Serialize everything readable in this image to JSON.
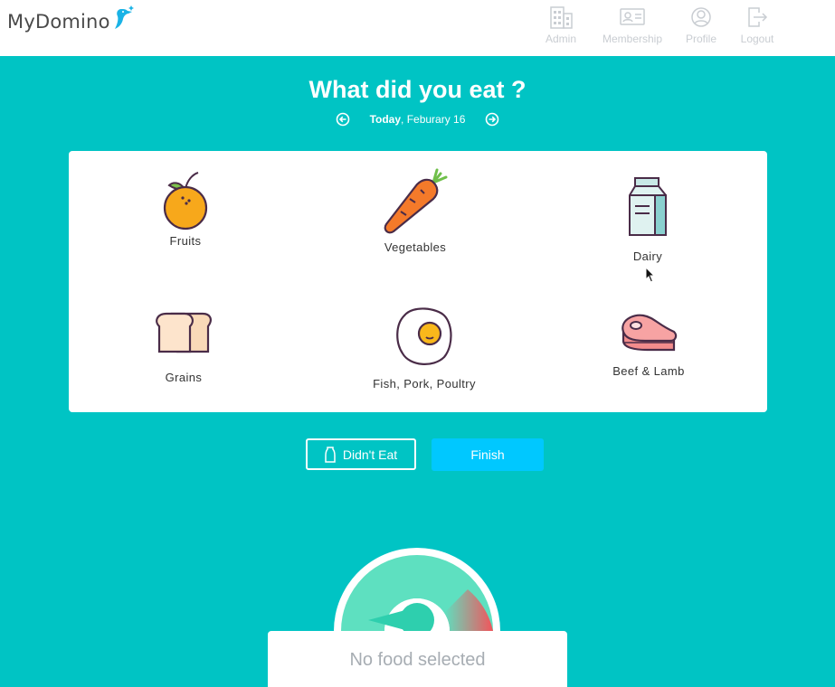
{
  "app": {
    "logo_text": "MyDomino"
  },
  "nav": {
    "items": [
      {
        "label": "Admin",
        "icon": "building-icon"
      },
      {
        "label": "Membership",
        "icon": "id-card-icon"
      },
      {
        "label": "Profile",
        "icon": "user-circle-icon"
      },
      {
        "label": "Logout",
        "icon": "logout-icon"
      }
    ]
  },
  "page": {
    "title": "What did you eat ?",
    "date_bold": "Today",
    "date_rest": ", Feburary 16"
  },
  "foods": [
    {
      "label": "Fruits",
      "icon": "orange-icon"
    },
    {
      "label": "Vegetables",
      "icon": "carrot-icon"
    },
    {
      "label": "Dairy",
      "icon": "milk-carton-icon"
    },
    {
      "label": "Grains",
      "icon": "bread-icon"
    },
    {
      "label": "Fish, Pork, Poultry",
      "icon": "egg-icon"
    },
    {
      "label": "Beef & Lamb",
      "icon": "steak-icon"
    }
  ],
  "actions": {
    "didnt_eat": "Didn't Eat",
    "finish": "Finish"
  },
  "gauge": {
    "status": "No food selected"
  },
  "colors": {
    "background": "#00c4c4",
    "finish_button": "#00c8ff",
    "gauge_fill": "#5ee0c0",
    "gauge_needle": "#2ecfae",
    "gauge_red": "#f2545b",
    "nav_text": "#c9cdd2"
  }
}
